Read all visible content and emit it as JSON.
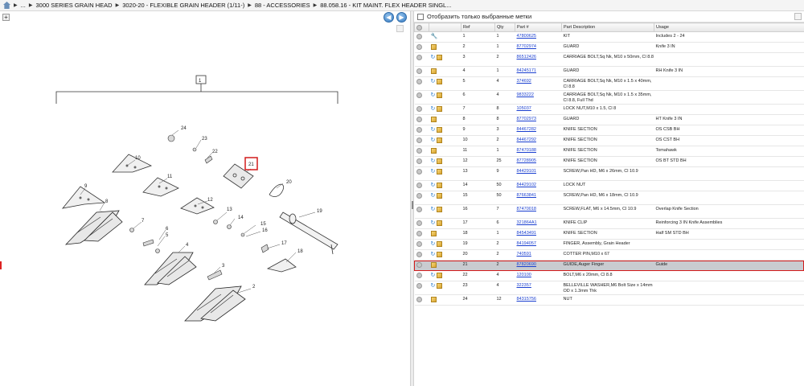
{
  "breadcrumb": {
    "root": "...",
    "items": [
      "3000 SERIES GRAIN HEAD",
      "3020-20 - FLEXIBLE GRAIN HEADER (1/11-)",
      "88 - ACCESSORIES",
      "88.058.16 - KIT MAINT. FLEX HEADER SINGL..."
    ]
  },
  "filter": {
    "checkbox_label": "Отобразить только выбранные метки"
  },
  "table": {
    "headers": [
      "Ref",
      "Qty",
      "Part #",
      "Part Description",
      "Usage"
    ],
    "rows": [
      {
        "ref": "1",
        "qty": "1",
        "part": "47800625",
        "desc": "KIT",
        "usage": "Includes 2 - 24",
        "icons": "wrench"
      },
      {
        "ref": "2",
        "qty": "1",
        "part": "87702974",
        "desc": "GUARD",
        "usage": "Knife 3 IN",
        "icons": "box"
      },
      {
        "ref": "3",
        "qty": "2",
        "part": "86512426",
        "desc": "CARRIAGE BOLT,Sq Nk, M10 x 50mm, Cl 8.8",
        "usage": "",
        "icons": "arrow-box"
      },
      {
        "ref": "4",
        "qty": "1",
        "part": "84245171",
        "desc": "GUARD",
        "usage": "RH Knife 3 IN",
        "icons": "box"
      },
      {
        "ref": "5",
        "qty": "4",
        "part": "374692",
        "desc": "CARRIAGE BOLT,Sq Nk, M10 x 1.5 x 40mm, Cl 8.8",
        "usage": "",
        "icons": "arrow-box"
      },
      {
        "ref": "6",
        "qty": "4",
        "part": "9833222",
        "desc": "CARRIAGE BOLT,Sq Nk, M10 x 1.5 x 35mm, Cl 8.8, Full Thd",
        "usage": "",
        "icons": "arrow-box"
      },
      {
        "ref": "7",
        "qty": "8",
        "part": "105037",
        "desc": "LOCK NUT,M10 x 1.5, Cl 8",
        "usage": "",
        "icons": "arrow-box"
      },
      {
        "ref": "8",
        "qty": "8",
        "part": "87702973",
        "desc": "GUARD",
        "usage": "HT Knife 3 IN",
        "icons": "box"
      },
      {
        "ref": "9",
        "qty": "3",
        "part": "84467282",
        "desc": "KNIFE SECTION",
        "usage": "OS CSB BH",
        "icons": "arrow-box"
      },
      {
        "ref": "10",
        "qty": "2",
        "part": "84467292",
        "desc": "KNIFE SECTION",
        "usage": "OS CST BH",
        "icons": "arrow-box"
      },
      {
        "ref": "11",
        "qty": "1",
        "part": "87470188",
        "desc": "KNIFE SECTION",
        "usage": "Tomahawk",
        "icons": "box"
      },
      {
        "ref": "12",
        "qty": "25",
        "part": "87728905",
        "desc": "KNIFE SECTION",
        "usage": "OS BT STD BH",
        "icons": "arrow-box"
      },
      {
        "ref": "13",
        "qty": "9",
        "part": "84429101",
        "desc": "SCREW,Pan HD, M6 x 26mm, Cl 10.9",
        "usage": "",
        "icons": "arrow-box"
      },
      {
        "ref": "14",
        "qty": "50",
        "part": "84429102",
        "desc": "LOCK NUT",
        "usage": "",
        "icons": "arrow-box"
      },
      {
        "ref": "15",
        "qty": "50",
        "part": "87663841",
        "desc": "SCREW,Pan HD, M6 x 18mm, Cl 10.9",
        "usage": "",
        "icons": "arrow-box"
      },
      {
        "ref": "16",
        "qty": "7",
        "part": "87470018",
        "desc": "SCREW,FLAT, M6 x 14.5mm, Cl 10.9",
        "usage": "Overlap Knife Section",
        "icons": "arrow-box"
      },
      {
        "ref": "17",
        "qty": "6",
        "part": "321864A1",
        "desc": "KNIFE CLIP",
        "usage": "Reinforcing 3 IN Knife Assemblies",
        "icons": "arrow-box"
      },
      {
        "ref": "18",
        "qty": "1",
        "part": "84543491",
        "desc": "KNIFE SECTION",
        "usage": "Half SM STD BH",
        "icons": "box"
      },
      {
        "ref": "19",
        "qty": "2",
        "part": "84194057",
        "desc": "FINGER, Assembly, Grain Header",
        "usage": "",
        "icons": "arrow-box"
      },
      {
        "ref": "20",
        "qty": "2",
        "part": "740591",
        "desc": "COTTER PIN,M10 x 67",
        "usage": "",
        "icons": "arrow-box"
      },
      {
        "ref": "21",
        "qty": "2",
        "part": "87820690",
        "desc": "GUIDE,Auger Finger",
        "usage": "Guide",
        "icons": "box",
        "selected": true
      },
      {
        "ref": "22",
        "qty": "4",
        "part": "120100",
        "desc": "BOLT,M6 x 20mm, Cl 8.8",
        "usage": "",
        "icons": "arrow-box"
      },
      {
        "ref": "23",
        "qty": "4",
        "part": "322357",
        "desc": "BELLEVILLE WASHER,M6 Bolt Size x 14mm OD x 1.3mm Thk",
        "usage": "",
        "icons": "arrow-box"
      },
      {
        "ref": "24",
        "qty": "12",
        "part": "84315756",
        "desc": "NUT",
        "usage": "",
        "icons": "box"
      }
    ]
  },
  "diagram": {
    "callouts": [
      "1",
      "2",
      "3",
      "4",
      "5",
      "6",
      "7",
      "8",
      "9",
      "10",
      "11",
      "12",
      "13",
      "14",
      "15",
      "16",
      "17",
      "18",
      "19",
      "20",
      "21",
      "22",
      "23",
      "24"
    ],
    "highlighted": "21"
  },
  "icons": {
    "home": "home-icon",
    "back": "back-arrow-icon",
    "forward": "forward-arrow-icon"
  },
  "colors": {
    "link": "#1a3fd0",
    "highlight": "#d21b1b",
    "selected_row": "#c9cbd0"
  }
}
